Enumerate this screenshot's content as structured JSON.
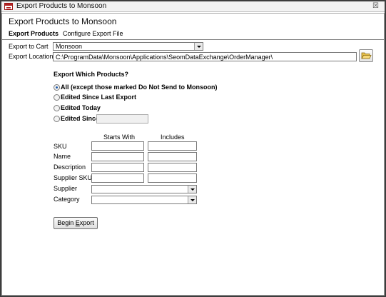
{
  "window": {
    "title": "Export Products to Monsoon",
    "close_glyph": "☒",
    "app_icon": "access-form-icon"
  },
  "form": {
    "title": "Export Products to Monsoon",
    "tabs": [
      {
        "label": "Export Products",
        "active": true
      },
      {
        "label": "Configure Export File",
        "active": false
      }
    ]
  },
  "export_to_cart": {
    "label": "Export to Cart",
    "value": "Monsoon"
  },
  "export_location": {
    "label": "Export Location",
    "value": "C:\\ProgramData\\Monsoon\\Applications\\SeomDataExchange\\OrderManager\\",
    "browse_icon": "folder-open-icon"
  },
  "which_products": {
    "heading": "Export Which Products?",
    "options": [
      {
        "label": "All (except those marked Do Not Send to Monsoon)",
        "selected": true
      },
      {
        "label": "Edited Since Last Export",
        "selected": false
      },
      {
        "label": "Edited Today",
        "selected": false
      },
      {
        "label": "Edited Since:",
        "selected": false,
        "date_value": ""
      }
    ]
  },
  "filters": {
    "starts_with_header": "Starts With",
    "includes_header": "Includes",
    "text_rows": [
      {
        "label": "SKU",
        "starts_with": "",
        "includes": ""
      },
      {
        "label": "Name",
        "starts_with": "",
        "includes": ""
      },
      {
        "label": "Description",
        "starts_with": "",
        "includes": ""
      },
      {
        "label": "Supplier SKU",
        "starts_with": "",
        "includes": ""
      }
    ],
    "combo_rows": [
      {
        "label": "Supplier",
        "value": ""
      },
      {
        "label": "Category",
        "value": ""
      }
    ]
  },
  "begin_export": {
    "label_prefix": "Begin ",
    "label_mnemonic": "E",
    "label_suffix": "xport"
  },
  "colors": {
    "window_border": "#3d3d3d",
    "radio_selected": "#1e5aa8",
    "folder_yellow": "#e8c04a",
    "icon_red": "#b22222"
  }
}
